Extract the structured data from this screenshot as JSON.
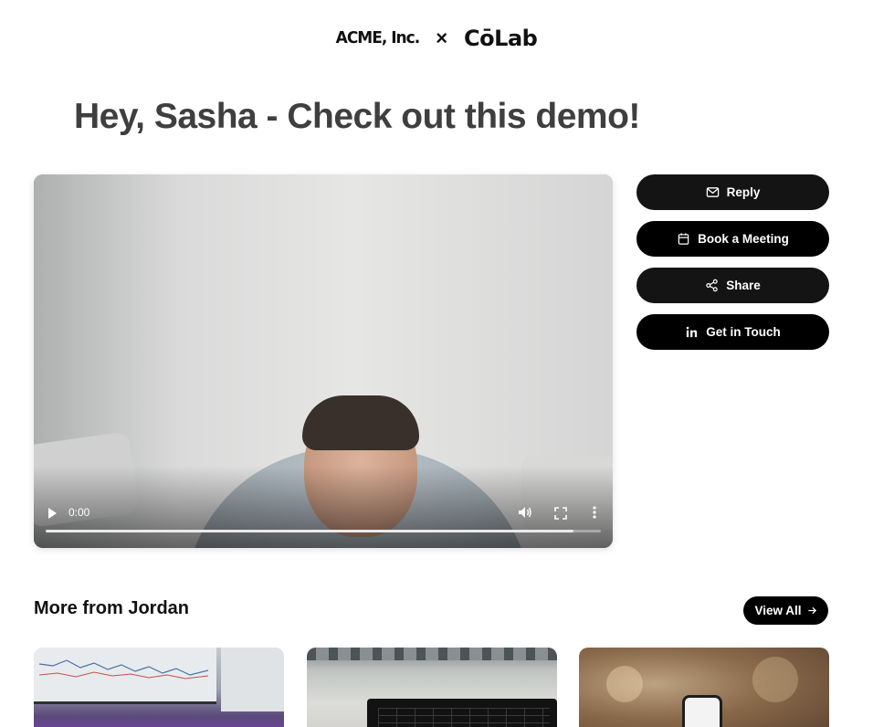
{
  "header": {
    "brand_left": "ACME, Inc.",
    "brand_separator": "×",
    "brand_right": "CōLab"
  },
  "page_title": "Hey, Sasha - Check out this demo!",
  "video": {
    "current_time": "0:00",
    "buffered_fraction": 0.95
  },
  "actions": [
    {
      "label": "Reply",
      "icon": "mail-icon"
    },
    {
      "label": "Book a Meeting",
      "icon": "calendar-icon"
    },
    {
      "label": "Share",
      "icon": "share-icon"
    },
    {
      "label": "Get in Touch",
      "icon": "linkedin-icon"
    }
  ],
  "more_section": {
    "title": "More from Jordan",
    "view_all_label": "View All"
  },
  "colors": {
    "button_bg": "#141414",
    "title_text": "#3f3f3f"
  }
}
